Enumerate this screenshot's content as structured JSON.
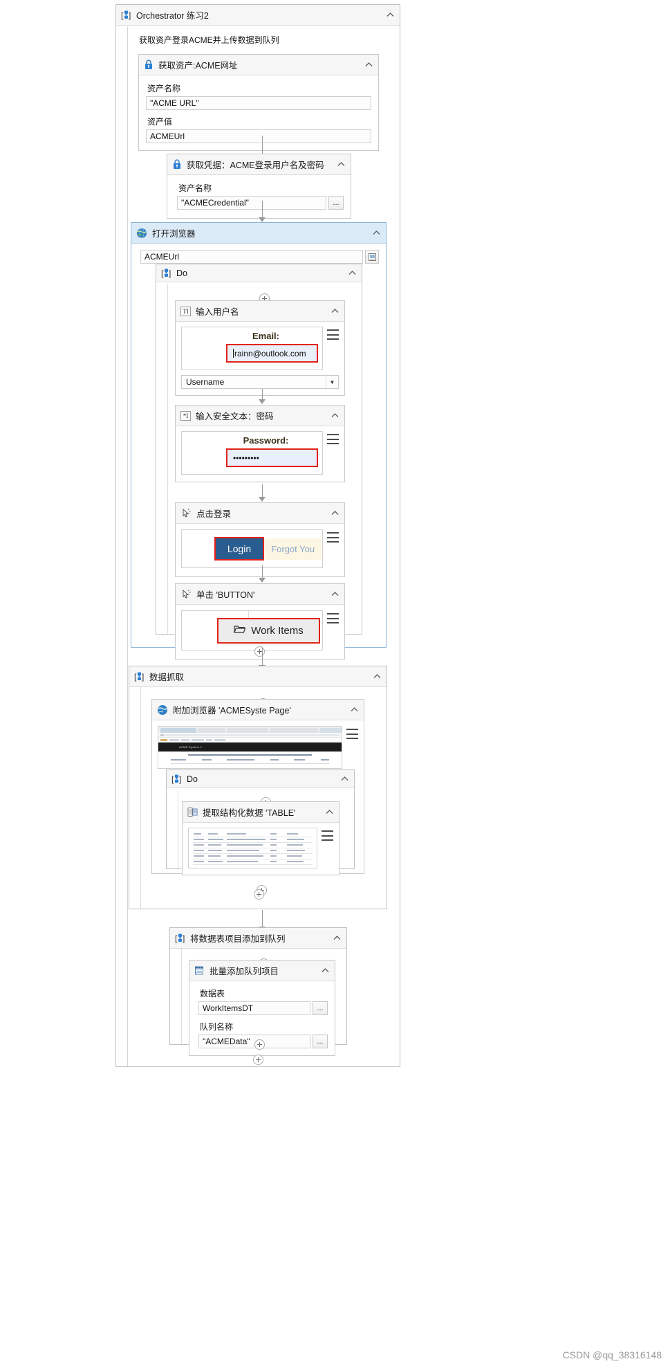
{
  "root": {
    "title": "Orchestrator 练习2",
    "icon": "sequence-icon",
    "subtitle": "获取资产登录ACME并上传数据到队列",
    "collapse_glyph": "⌃"
  },
  "get_asset": {
    "title": "获取资产:ACME网址",
    "icon": "lock-icon",
    "asset_name_label": "资产名称",
    "asset_name_value": "\"ACME URL\"",
    "asset_value_label": "资产值",
    "asset_value_value": "ACMEUrl"
  },
  "get_credential": {
    "title": "获取凭据：ACME登录用户名及密码",
    "icon": "lock-icon",
    "asset_name_label": "资产名称",
    "asset_name_value": "\"ACMECredential\"",
    "browse_label": "..."
  },
  "open_browser": {
    "title": "打开浏览器",
    "icon": "globe-icon",
    "url_value": "ACMEUrl",
    "picker_label": "▣",
    "do": {
      "title": "Do",
      "icon": "sequence-icon"
    }
  },
  "type_username": {
    "title": "输入用户名",
    "icon": "type-into-icon",
    "field_caption": "Email:",
    "field_value": "rainn@outlook.com",
    "variable": "Username",
    "menu_icon": "hamburger-icon"
  },
  "type_password": {
    "title": "输入安全文本：密码",
    "icon": "type-secure-icon",
    "field_caption": "Password:",
    "field_value": "•••••••••",
    "menu_icon": "hamburger-icon"
  },
  "click_login": {
    "title": "点击登录",
    "icon": "click-icon",
    "button_label": "Login",
    "secondary_label": "Forgot You",
    "menu_icon": "hamburger-icon"
  },
  "click_button": {
    "title": "单击 'BUTTON'",
    "icon": "click-icon",
    "button_label": "Work Items",
    "folder_icon": "folder-icon",
    "menu_icon": "hamburger-icon"
  },
  "data_scraping": {
    "title": "数据抓取",
    "icon": "sequence-icon",
    "attach_browser": {
      "title": "附加浏览器 'ACMESyste Page'",
      "icon": "globe-icon",
      "menu_icon": "hamburger-icon",
      "page_banner": "ACME System 1",
      "page_note": "Please note below you can see the Work Items that are assigned to this user (both open and in progress)"
    },
    "do": {
      "title": "Do",
      "icon": "sequence-icon"
    },
    "extract_table": {
      "title": "提取结构化数据 'TABLE'",
      "icon": "extract-table-icon",
      "menu_icon": "hamburger-icon"
    }
  },
  "add_queue": {
    "title": "将数据表项目添加到队列",
    "icon": "sequence-icon",
    "bulk_add": {
      "title": "批量添加队列项目",
      "icon": "queue-icon",
      "datatable_label": "数据表",
      "datatable_value": "WorkItemsDT",
      "queue_label": "队列名称",
      "queue_value": "\"ACMEData\"",
      "browse_label": "..."
    }
  },
  "watermark": "CSDN @qq_38316148",
  "colors": {
    "header_bg": "#f6f6f6",
    "browser_header_bg": "#dbeaf7",
    "selection_red": "#e2231a",
    "login_blue": "#2a5d8f",
    "icon_blue": "#2b7fd4"
  }
}
